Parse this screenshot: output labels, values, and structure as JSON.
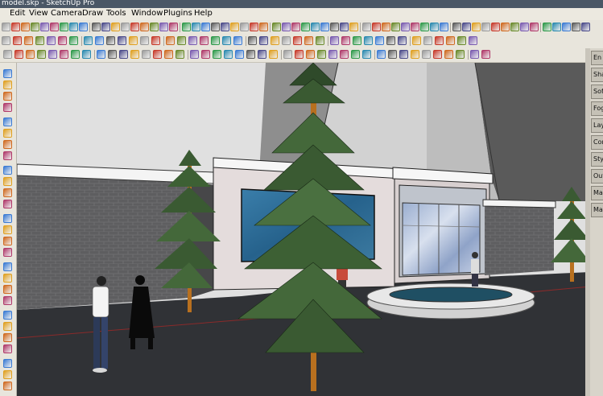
{
  "window": {
    "title": "model.skp - SketchUp Pro"
  },
  "menu": {
    "items": [
      "Edit",
      "View",
      "Camera",
      "Draw",
      "Tools",
      "Window",
      "Plugins",
      "Help"
    ]
  },
  "tray": {
    "tabs": [
      "En",
      "Sha",
      "Sof",
      "Fog",
      "Lay",
      "Cor",
      "Sty",
      "Out",
      "Ma",
      "Ma"
    ]
  },
  "colors": {
    "sky": "#dedede",
    "ground": "#303236",
    "brick": "#5e5e60",
    "glass_blue": "#2f6b95",
    "trunk": "#b8701f",
    "foliage": "#3a5a32",
    "fountain_water": "#1f4f63"
  },
  "icons": {
    "row1": [
      "select-icon",
      "eraser-icon",
      "paint-bucket-icon",
      "arc-icon",
      "component-icon",
      "box-icon",
      "orbit-icon",
      "walk-icon",
      "rotate-icon",
      "axes-icon",
      "tape-measure-icon",
      "dimension-icon",
      "protractor-icon",
      "text-icon",
      "3d-text-icon",
      "section-plane-icon",
      "camera-icon",
      "look-around-icon",
      "position-camera-icon",
      "zoom-icon",
      "zoom-window-icon",
      "zoom-extents-icon",
      "previous-view-icon",
      "next-view-icon",
      "pan-icon",
      "measure-icon",
      "delete-icon",
      "shape-icon",
      "polygon-icon",
      "circle-icon",
      "offset-icon",
      "follow-me-icon",
      "intersect-icon",
      "scale-icon",
      "move-icon",
      "push-pull-icon",
      "sandbox-icon",
      "terrain-icon",
      "smoove-icon",
      "stamp-icon",
      "drape-icon",
      "add-detail-icon",
      "flip-edge-icon",
      "solid-union-icon",
      "solid-subtract-icon",
      "solid-trim-icon",
      "solid-split-icon",
      "red-cube-icon",
      "brown-cube-icon",
      "orange-cube-icon",
      "gem-icon",
      "sphere-icon",
      "ring-icon",
      "teapot-icon",
      "mushroom-icon",
      "chair-icon",
      "shield-icon",
      "lamp-icon",
      "tree-icon"
    ],
    "row2": [
      "new-icon",
      "open-icon",
      "save-icon",
      "cut-icon",
      "copy-icon",
      "paste-icon",
      "erase-icon",
      "undo-icon",
      "redo-icon",
      "print-icon",
      "model-info-icon",
      "x-ray-icon",
      "back-edges-icon",
      "wireframe-icon",
      "hidden-line-icon",
      "shaded-icon",
      "textured-icon",
      "monochrome-icon",
      "iso-icon",
      "top-view-icon",
      "front-view-icon",
      "right-view-icon",
      "back-view-icon",
      "left-view-icon",
      "shadows-icon",
      "fog-icon",
      "edges-icon",
      "profiles-icon",
      "depth-cue-icon",
      "extension-icon",
      "endpoints-icon",
      "jitter-icon",
      "sketchy-icon",
      "hatch-icon",
      "display-icon",
      "sections-icon",
      "cuts-icon",
      "layers-icon",
      "outliner-icon",
      "materials-icon",
      "styles-icon"
    ],
    "row3": [
      "line-icon",
      "freehand-icon",
      "rectangle-icon",
      "rotated-rect-icon",
      "circle-tool-icon",
      "polygon-tool-icon",
      "arc-2pt-icon",
      "arc-3pt-icon",
      "pie-icon",
      "tape-icon",
      "protractor-tool-icon",
      "axes-tool-icon",
      "dimension-tool-icon",
      "text-tool-icon",
      "move-tool-icon",
      "push-pull-tool-icon",
      "rotate-tool-icon",
      "follow-me-tool-icon",
      "scale-tool-icon",
      "offset-tool-icon",
      "outer-shell-icon",
      "intersect-tool-icon",
      "union-tool-icon",
      "subtract-tool-icon",
      "trim-tool-icon",
      "split-tool-icon",
      "sandbox-scratch-icon",
      "sandbox-contours-icon",
      "smoove-tool-icon",
      "stamp-tool-icon",
      "drape-tool-icon",
      "add-detail-tool-icon",
      "flip-edge-tool-icon",
      "layer-icon",
      "material-icon",
      "component-tool-icon",
      "group-icon",
      "explode-icon",
      "hide-icon",
      "unhide-icon",
      "lock-icon",
      "unlock-icon"
    ],
    "left": [
      "select-tool-icon",
      "component-make-icon",
      "paint-tool-icon",
      "eraser-tool-icon",
      "pencil-icon",
      "arc-tool-icon",
      "circle-left-icon",
      "polygon-left-icon",
      "push-left-icon",
      "move-left-icon",
      "rotate-left-icon",
      "follow-left-icon",
      "scale-left-icon",
      "offset-left-icon",
      "tape-left-icon",
      "dim-left-icon",
      "protractor-left-icon",
      "text-left-icon",
      "axes-left-icon",
      "3dtext-left-icon",
      "orbit-left-icon",
      "pan-left-icon",
      "zoom-left-icon",
      "zoom-window-left-icon",
      "zoom-ext-left-icon",
      "walk-left-icon",
      "look-left-icon",
      "position-left-icon",
      "section-left-icon"
    ]
  }
}
